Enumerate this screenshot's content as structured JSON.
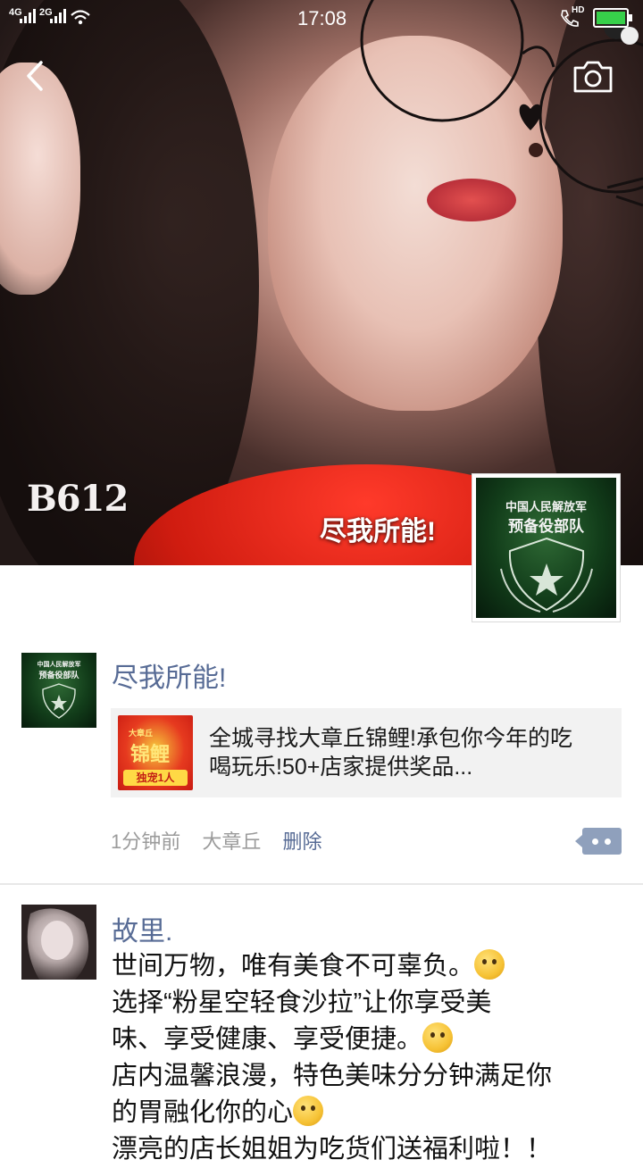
{
  "status_bar": {
    "time": "17:08",
    "signal1": "4G",
    "signal2": "2G",
    "call_badge": "HD"
  },
  "cover": {
    "watermark": "B612",
    "name": "尽我所能!"
  },
  "avatar_emblem": {
    "line1": "中国人民解放军",
    "line2": "预备役部队"
  },
  "moment": {
    "author": "尽我所能!",
    "link": {
      "thumb_top": "大章丘",
      "thumb_main": "锦鲤",
      "thumb_bottom": "独宠1人",
      "title_line1": "全城寻找大章丘锦鲤!承包你今年的吃",
      "title_line2": "喝玩乐!50+店家提供奖品..."
    },
    "time": "1分钟前",
    "location": "大章丘",
    "delete_label": "删除"
  },
  "post2": {
    "author": "故里.",
    "lines": [
      "世间万物，唯有美食不可辜负。",
      "选择“粉星空轻食沙拉”让你享受美",
      "味、享受健康、享受便捷。",
      "店内温馨浪漫，特色美味分分钟满足你",
      "的胃融化你的心",
      "漂亮的店长姐姐为吃货们送福利啦！！"
    ]
  },
  "colors": {
    "link_blue": "#576b95",
    "meta_grey": "#9b9b9b",
    "card_bg": "#f2f2f2",
    "more_button": "#8fa0bc"
  },
  "icons": [
    "back-icon",
    "camera-icon",
    "wifi-icon",
    "battery-icon",
    "more-icon"
  ]
}
